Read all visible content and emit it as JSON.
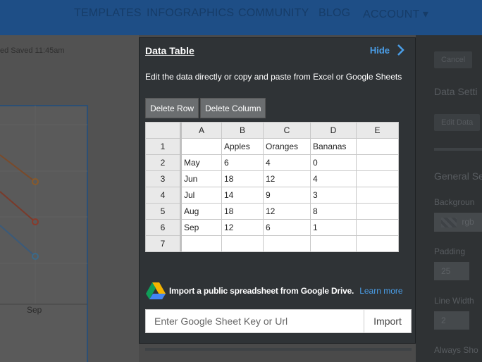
{
  "nav": {
    "items": [
      "TEMPLATES",
      "INFOGRAPHICS",
      "COMMUNITY",
      "BLOG",
      "ACCOUNT ▾"
    ]
  },
  "left": {
    "saved_text": "ed Saved 11:45am",
    "axis_tick": "Sep"
  },
  "right": {
    "cancel": "Cancel",
    "data_settings": "Data Setti",
    "edit_data": "Edit Data",
    "general": "General Se",
    "background": "Backgroun",
    "bg_value": "rgb",
    "padding": "Padding",
    "padding_value": "25",
    "line_width": "Line Width",
    "line_width_value": "2",
    "always_show": "Always Sho"
  },
  "modal": {
    "title": "Data Table",
    "hide_label": "Hide",
    "description": "Edit the data directly or copy and paste from Excel or Google Sheets",
    "delete_row": "Delete Row",
    "delete_column": "Delete Column",
    "columns": [
      "A",
      "B",
      "C",
      "D",
      "E"
    ],
    "rows": [
      {
        "num": "1",
        "cells": [
          "",
          "Apples",
          "Oranges",
          "Bananas",
          ""
        ]
      },
      {
        "num": "2",
        "cells": [
          "May",
          "6",
          "4",
          "0",
          ""
        ]
      },
      {
        "num": "3",
        "cells": [
          "Jun",
          "18",
          "12",
          "4",
          ""
        ]
      },
      {
        "num": "4",
        "cells": [
          "Jul",
          "14",
          "9",
          "3",
          ""
        ]
      },
      {
        "num": "5",
        "cells": [
          "Aug",
          "18",
          "12",
          "8",
          ""
        ]
      },
      {
        "num": "6",
        "cells": [
          "Sep",
          "12",
          "6",
          "1",
          ""
        ]
      },
      {
        "num": "7",
        "cells": [
          "",
          "",
          "",
          "",
          ""
        ]
      }
    ],
    "gdrive_text": "Import a public spreadsheet from Google Drive.",
    "learn_more": "Learn more",
    "import_placeholder": "Enter Google Sheet Key or Url",
    "import_button": "Import"
  },
  "colors": {
    "accent": "#4a9ee8",
    "modal_bg": "#2f3336",
    "nav_bg": "#1e4e86"
  }
}
